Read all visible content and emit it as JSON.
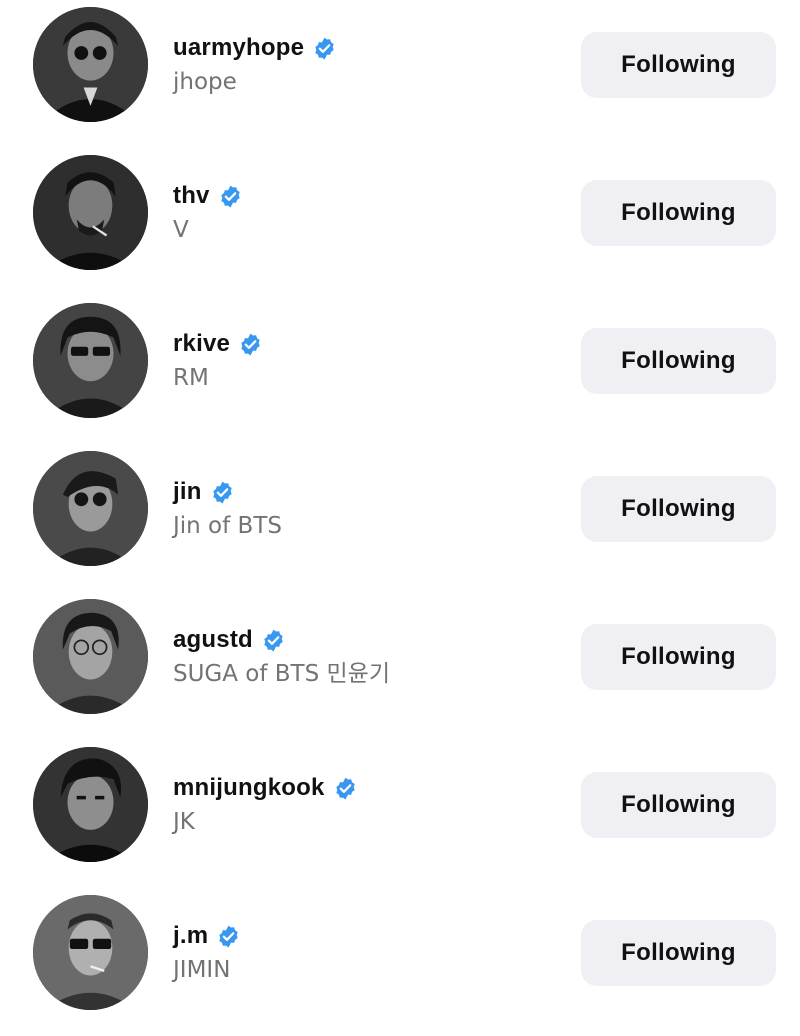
{
  "accent_color": "#3897f0",
  "button_bg": "#efeff4",
  "follow_list": [
    {
      "handle": "uarmyhope",
      "name": "jhope",
      "verified": true,
      "button": "Following",
      "avatar": "profile-photo"
    },
    {
      "handle": "thv",
      "name": "V",
      "verified": true,
      "button": "Following",
      "avatar": "profile-photo"
    },
    {
      "handle": "rkive",
      "name": "RM",
      "verified": true,
      "button": "Following",
      "avatar": "profile-photo"
    },
    {
      "handle": "jin",
      "name": "Jin of BTS",
      "verified": true,
      "button": "Following",
      "avatar": "profile-photo"
    },
    {
      "handle": "agustd",
      "name": "SUGA of BTS 민윤기",
      "verified": true,
      "button": "Following",
      "avatar": "profile-photo"
    },
    {
      "handle": "mnijungkook",
      "name": "JK",
      "verified": true,
      "button": "Following",
      "avatar": "profile-photo"
    },
    {
      "handle": "j.m",
      "name": "JIMIN",
      "verified": true,
      "button": "Following",
      "avatar": "profile-photo"
    }
  ]
}
